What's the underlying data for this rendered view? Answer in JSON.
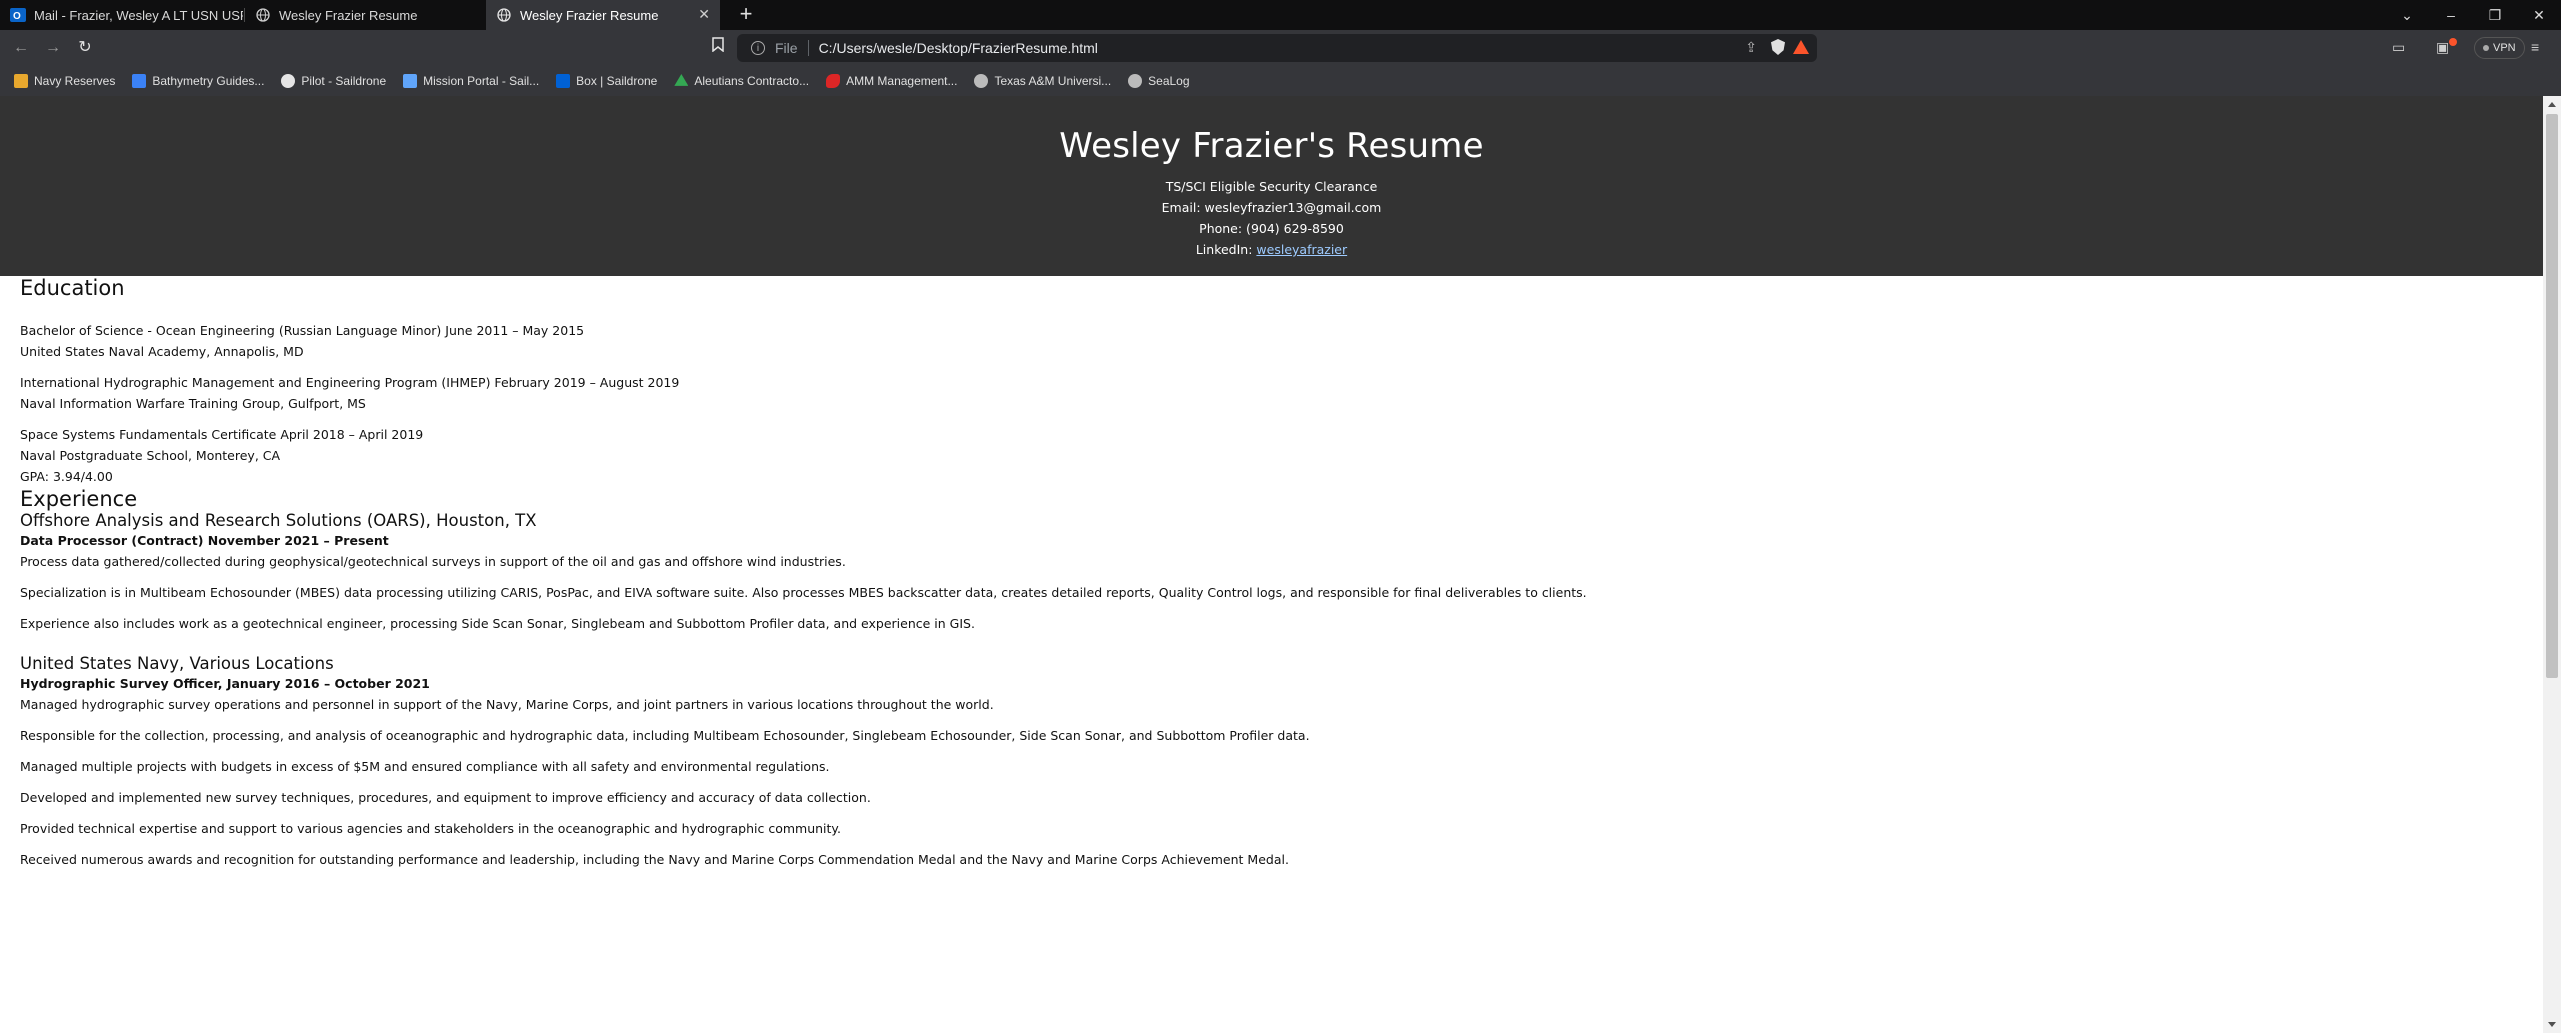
{
  "browser": {
    "tabs": [
      {
        "title": "Mail - Frazier, Wesley A LT USN USFFC",
        "icon": "outlook-icon"
      },
      {
        "title": "Wesley Frazier Resume",
        "icon": "globe-icon"
      },
      {
        "title": "Wesley Frazier Resume",
        "icon": "globe-icon",
        "active": true
      }
    ],
    "address": {
      "scheme": "File",
      "url": "C:/Users/wesle/Desktop/FrazierResume.html"
    },
    "vpn_label": "VPN",
    "bookmarks": [
      {
        "label": "Navy Reserves",
        "icon": "folder-icon",
        "color": "#e8a82e"
      },
      {
        "label": "Bathymetry Guides...",
        "icon": "chart-icon",
        "color": "#3b82f6"
      },
      {
        "label": "Pilot - Saildrone",
        "icon": "compass-icon",
        "color": "#e5e5e5"
      },
      {
        "label": "Mission Portal - Sail...",
        "icon": "trend-icon",
        "color": "#60a5fa"
      },
      {
        "label": "Box | Saildrone",
        "icon": "box-icon",
        "color": "#0061d5"
      },
      {
        "label": "Aleutians Contracto...",
        "icon": "drive-icon",
        "color": "#34a853"
      },
      {
        "label": "AMM Management...",
        "icon": "fish-icon",
        "color": "#dc2626"
      },
      {
        "label": "Texas A&M Universi...",
        "icon": "globe-icon",
        "color": "#bbbbbb"
      },
      {
        "label": "SeaLog",
        "icon": "globe-icon",
        "color": "#bbbbbb"
      }
    ]
  },
  "resume": {
    "name": "Wesley Frazier's Resume",
    "clearance": "TS/SCI Eligible Security Clearance",
    "email": "Email: wesleyfrazier13@gmail.com",
    "phone": "Phone: (904) 629-8590",
    "linkedin_label": "LinkedIn: ",
    "linkedin_link": "wesleyafrazier",
    "education_heading": "Education",
    "education": [
      {
        "line1": "Bachelor of Science - Ocean Engineering (Russian Language Minor) June 2011 – May 2015",
        "line2": "United States Naval Academy, Annapolis, MD"
      },
      {
        "line1": "International Hydrographic Management and Engineering Program (IHMEP) February 2019 – August 2019",
        "line2": "Naval Information Warfare Training Group, Gulfport, MS"
      },
      {
        "line1": "Space Systems Fundamentals Certificate April 2018 – April 2019",
        "line2": "Naval Postgraduate School, Monterey, CA",
        "line3": "GPA: 3.94/4.00"
      }
    ],
    "experience_heading": "Experience",
    "jobs": [
      {
        "org": "Offshore Analysis and Research Solutions (OARS), Houston, TX",
        "position": "Data Processor (Contract) November 2021 – Present",
        "duties": [
          "Process data gathered/collected during geophysical/geotechnical surveys in support of the oil and gas and offshore wind industries.",
          "Specialization is in Multibeam Echosounder (MBES) data processing utilizing CARIS, PosPac, and EIVA software suite. Also processes MBES backscatter data, creates detailed reports, Quality Control logs, and responsible for final deliverables to clients.",
          "Experience also includes work as a geotechnical engineer, processing Side Scan Sonar, Singlebeam and Subbottom Profiler data, and experience in GIS."
        ]
      },
      {
        "org": "United States Navy, Various Locations",
        "position": "Hydrographic Survey Officer, January 2016 – October 2021",
        "duties": [
          "Managed hydrographic survey operations and personnel in support of the Navy, Marine Corps, and joint partners in various locations throughout the world.",
          "Responsible for the collection, processing, and analysis of oceanographic and hydrographic data, including Multibeam Echosounder, Singlebeam Echosounder, Side Scan Sonar, and Subbottom Profiler data.",
          "Managed multiple projects with budgets in excess of $5M and ensured compliance with all safety and environmental regulations.",
          "Developed and implemented new survey techniques, procedures, and equipment to improve efficiency and accuracy of data collection.",
          "Provided technical expertise and support to various agencies and stakeholders in the oceanographic and hydrographic community.",
          "Received numerous awards and recognition for outstanding performance and leadership, including the Navy and Marine Corps Commendation Medal and the Navy and Marine Corps Achievement Medal."
        ]
      }
    ]
  }
}
